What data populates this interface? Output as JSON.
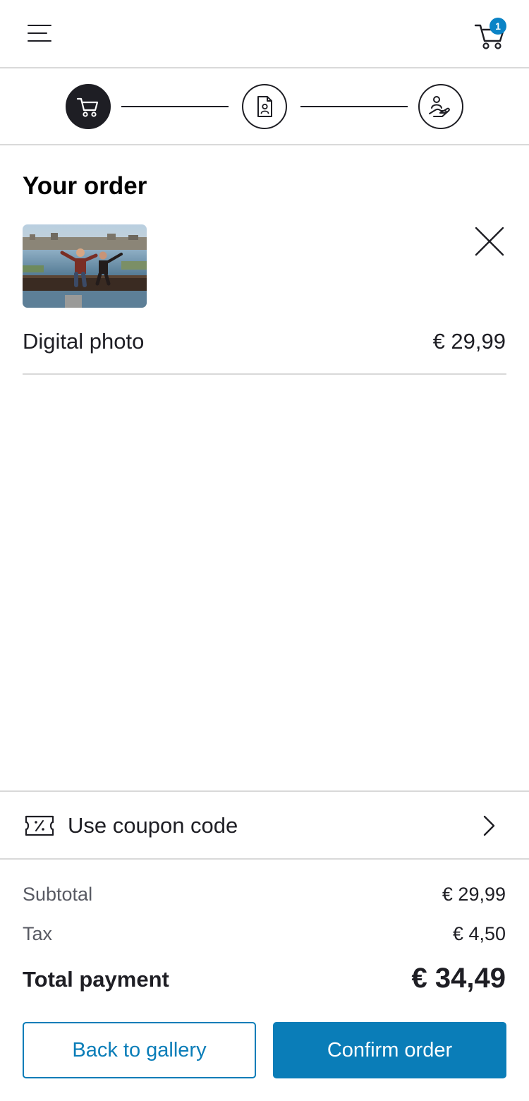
{
  "header": {
    "menu_icon": "hamburger-menu-icon",
    "cart_icon": "shopping-cart-icon",
    "cart_count": "1"
  },
  "stepper": {
    "steps": [
      {
        "icon": "shopping-cart-icon",
        "state": "active"
      },
      {
        "icon": "contact-document-icon",
        "state": "inactive"
      },
      {
        "icon": "person-hand-icon",
        "state": "inactive"
      }
    ]
  },
  "order": {
    "title": "Your order",
    "item": {
      "name": "Digital photo",
      "price": "€ 29,99",
      "thumbnail": "photo of two people sitting on a beam above a city harbour",
      "remove_icon": "close-icon"
    }
  },
  "coupon": {
    "icon": "coupon-ticket-icon",
    "label": "Use coupon code",
    "chevron_icon": "chevron-right-icon"
  },
  "summary": {
    "subtotal_label": "Subtotal",
    "subtotal_value": "€ 29,99",
    "tax_label": "Tax",
    "tax_value": "€ 4,50",
    "total_label": "Total payment",
    "total_value": "€ 34,49"
  },
  "actions": {
    "back_label": "Back to gallery",
    "confirm_label": "Confirm order"
  },
  "colors": {
    "accent": "#0a7db8",
    "badge": "#0a83c6",
    "text": "#1e1e24",
    "muted": "#585a63",
    "divider": "#d9d9d9"
  }
}
